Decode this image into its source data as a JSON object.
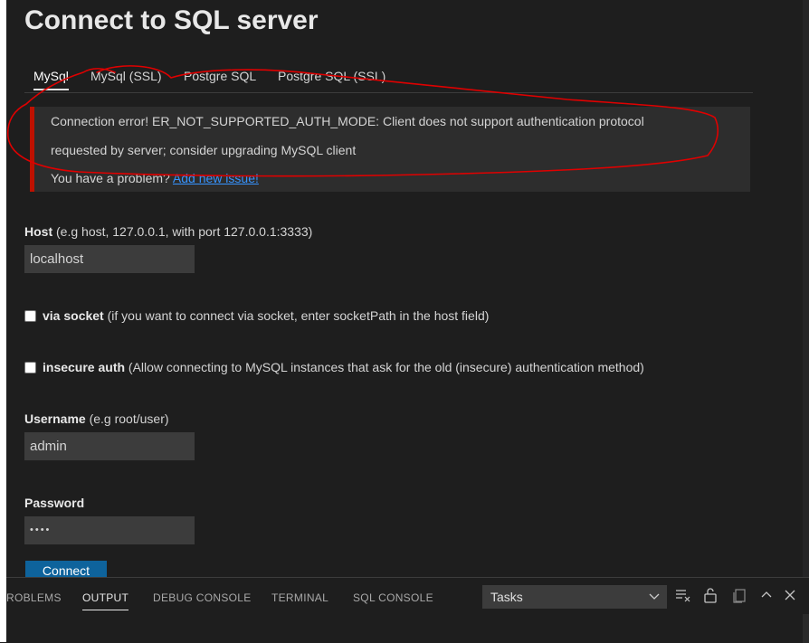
{
  "title": "Connect to SQL server",
  "tabs": [
    "MySql",
    "MySql (SSL)",
    "Postgre SQL",
    "Postgre SQL (SSL)"
  ],
  "error": {
    "line1": "Connection error! ER_NOT_SUPPORTED_AUTH_MODE: Client does not support authentication protocol",
    "line2": "requested by server; consider upgrading MySQL client",
    "problem_text": "You have a problem? ",
    "link_text": "Add new issue!",
    "accent_color": "#be1100"
  },
  "host": {
    "label": "Host",
    "hint": " (e.g host, 127.0.0.1, with port 127.0.0.1:3333)",
    "value": "localhost"
  },
  "socket": {
    "label": "via socket",
    "hint": " (if you want to connect via socket, enter socketPath in the host field)",
    "checked": false
  },
  "insecure": {
    "label": "insecure auth",
    "hint": " (Allow connecting to MySQL instances that ask for the old (insecure) authentication method)",
    "checked": false
  },
  "username": {
    "label": "Username",
    "hint": " (e.g root/user)",
    "value": "admin"
  },
  "password": {
    "label": "Password",
    "value": "••••"
  },
  "connect_label": "Connect",
  "panel": {
    "tabs": [
      "ROBLEMS",
      "OUTPUT",
      "DEBUG CONSOLE",
      "TERMINAL",
      "SQL CONSOLE"
    ],
    "active_tab": "OUTPUT",
    "select_value": "Tasks",
    "icons": [
      "clear-output-icon",
      "lock-icon",
      "copy-icon",
      "chevron-up-icon",
      "close-icon"
    ]
  },
  "colors": {
    "link": "#3794ff",
    "button": "#0e639c",
    "annotation": "#e00000"
  }
}
